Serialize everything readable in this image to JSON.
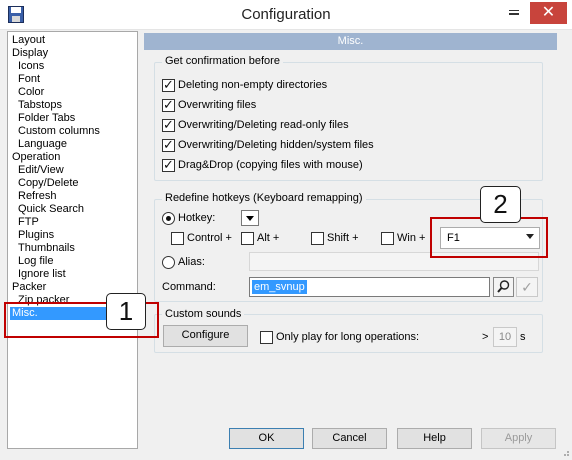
{
  "window": {
    "title": "Configuration",
    "close_glyph": "✕"
  },
  "tree": {
    "items": [
      {
        "label": "Layout",
        "indent": 0
      },
      {
        "label": "Display",
        "indent": 0
      },
      {
        "label": "Icons",
        "indent": 1
      },
      {
        "label": "Font",
        "indent": 1
      },
      {
        "label": "Color",
        "indent": 1
      },
      {
        "label": "Tabstops",
        "indent": 1
      },
      {
        "label": "Folder Tabs",
        "indent": 1
      },
      {
        "label": "Custom columns",
        "indent": 1
      },
      {
        "label": "Language",
        "indent": 1
      },
      {
        "label": "Operation",
        "indent": 0
      },
      {
        "label": "Edit/View",
        "indent": 1
      },
      {
        "label": "Copy/Delete",
        "indent": 1
      },
      {
        "label": "Refresh",
        "indent": 1
      },
      {
        "label": "Quick Search",
        "indent": 1
      },
      {
        "label": "FTP",
        "indent": 1
      },
      {
        "label": "Plugins",
        "indent": 1
      },
      {
        "label": "Thumbnails",
        "indent": 1
      },
      {
        "label": "Log file",
        "indent": 1
      },
      {
        "label": "Ignore list",
        "indent": 1
      },
      {
        "label": "Packer",
        "indent": 0
      },
      {
        "label": "Zip packer",
        "indent": 1
      },
      {
        "label": "Misc.",
        "indent": 0,
        "selected": true
      }
    ]
  },
  "panel": {
    "header": "Misc.",
    "confirmation": {
      "title": "Get confirmation before",
      "options": [
        {
          "label": "Deleting non-empty directories",
          "checked": true
        },
        {
          "label": "Overwriting files",
          "checked": true
        },
        {
          "label": "Overwriting/Deleting read-only files",
          "checked": true
        },
        {
          "label": "Overwriting/Deleting hidden/system files",
          "checked": true
        },
        {
          "label": "Drag&Drop (copying files with mouse)",
          "checked": true
        }
      ]
    },
    "hotkeys": {
      "title": "Redefine hotkeys (Keyboard remapping)",
      "hotkey_label": "Hotkey:",
      "hotkey_selected": true,
      "modifiers": [
        {
          "label": "Control +",
          "checked": false
        },
        {
          "label": "Alt +",
          "checked": false
        },
        {
          "label": "Shift +",
          "checked": false
        },
        {
          "label": "Win +",
          "checked": false
        }
      ],
      "key_value": "F1",
      "alias_label": "Alias:",
      "alias_value": "",
      "command_label": "Command:",
      "command_value": "em_svnup"
    },
    "sounds": {
      "title": "Custom sounds",
      "configure_label": "Configure",
      "long_ops_label": "Only play for long operations:",
      "long_ops_checked": false,
      "gt_symbol": ">",
      "seconds_value": "10",
      "seconds_unit": "s"
    }
  },
  "buttons": {
    "ok": "OK",
    "cancel": "Cancel",
    "help": "Help",
    "apply": "Apply"
  },
  "annotations": {
    "callout_1": "1",
    "callout_2": "2",
    "red_color": "#c00000"
  },
  "colors": {
    "header_bg": "#9fb4d0",
    "selection": "#3399ff",
    "close_button": "#c8443c"
  }
}
